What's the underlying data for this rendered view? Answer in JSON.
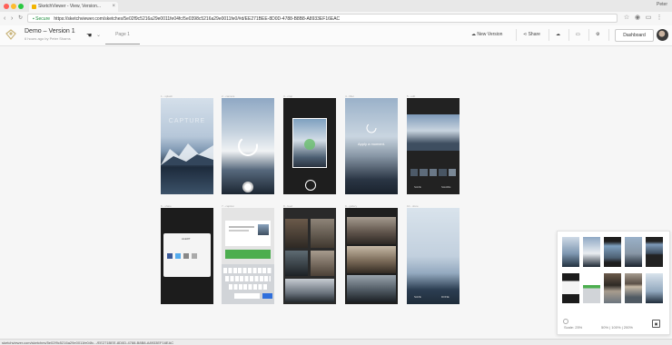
{
  "browser": {
    "tab_title": "SketchViewer - View, Version...",
    "tab_close": "×",
    "user": "Peter",
    "url_secure": "Secure",
    "url": "https://sketchviewer.com/sketches/5e02f9c5216a29e0011fe04fc/5e0398c5216a29e0011fe0/#d/EE271BEE-8D0D-4788-B8B8-A8933EF16EAC",
    "back": "‹",
    "forward": "›",
    "reload": "↻"
  },
  "app": {
    "doc_title": "Demo – Version 1",
    "doc_subtitle": "6 hours ago by Peter Shams",
    "page_tab": "Page 1",
    "buttons": {
      "new_version": "New Version",
      "share": "Share",
      "dashboard": "Dashboard"
    }
  },
  "canvas": {
    "artboard_labels": [
      "1 - splash",
      "2 - camera",
      "3 - crop",
      "4 - filter",
      "5 - edit",
      "6 - share",
      "7 - caption",
      "8 - feed",
      "9 - gallery",
      "10 - done"
    ],
    "splash_text": "CAPTURE",
    "filter_text": "Apply a moment.",
    "captions": [
      "ALERT",
      "SAVE",
      "SHARE",
      "SAVE",
      "DONE"
    ]
  },
  "minimap": {
    "scale_label": "Scale: 25%",
    "zoom_options": "50% | 100% | 200%",
    "toggle_icon": "▣"
  },
  "status": {
    "link": "sketchviewer.com/sketches/5e02f9c5216a29e0011fe04fc.../EE271BEE-8D0D-4788-B8B8-A8933EF16EAC"
  },
  "colors": {
    "traffic_red": "#ff5f57",
    "traffic_yellow": "#febc2e",
    "traffic_green": "#28c840",
    "keyboard_accent": "#2f6fdc",
    "share_green": "#4cae4f"
  }
}
